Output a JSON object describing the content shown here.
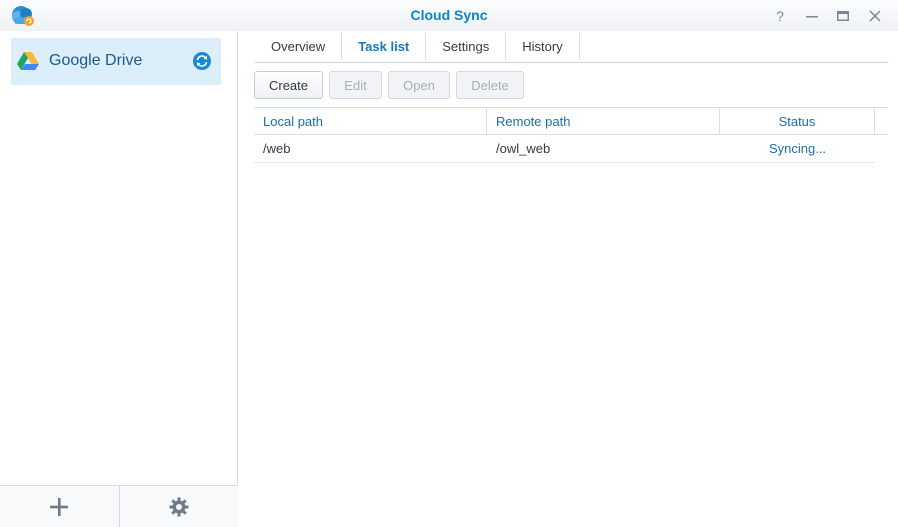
{
  "window": {
    "title": "Cloud Sync",
    "controls": [
      "help-icon",
      "minimize-icon",
      "maximize-icon",
      "close-icon"
    ]
  },
  "sidebar": {
    "providers": [
      {
        "label": "Google Drive",
        "icon": "google-drive-icon",
        "status_icon": "sync-icon",
        "selected": true
      }
    ],
    "footer": {
      "add_icon": "plus-icon",
      "settings_icon": "gear-icon"
    }
  },
  "tabs": [
    {
      "label": "Overview",
      "active": false
    },
    {
      "label": "Task list",
      "active": true
    },
    {
      "label": "Settings",
      "active": false
    },
    {
      "label": "History",
      "active": false
    }
  ],
  "toolbar": {
    "create": "Create",
    "edit": "Edit",
    "open": "Open",
    "delete": "Delete"
  },
  "table": {
    "columns": [
      "Local path",
      "Remote path",
      "Status"
    ],
    "rows": [
      {
        "local": "/web",
        "remote": "/owl_web",
        "status": "Syncing..."
      }
    ]
  },
  "colors": {
    "accent": "#0b83c9",
    "selected_bg": "#dceefa"
  }
}
